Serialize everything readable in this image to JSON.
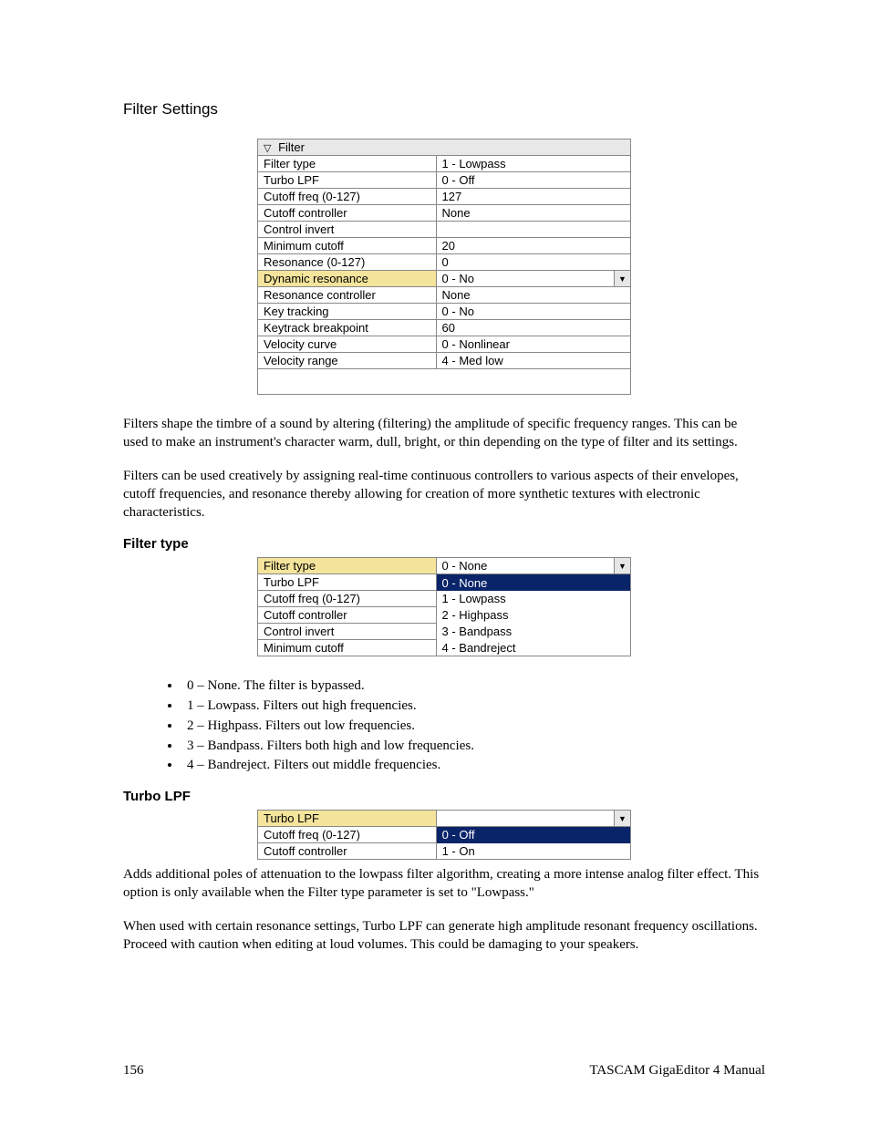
{
  "heading": "Filter Settings",
  "filter_table": {
    "header": "Filter",
    "rows": [
      {
        "label": "Filter type",
        "value": "1 - Lowpass"
      },
      {
        "label": "Turbo LPF",
        "value": "0 - Off"
      },
      {
        "label": "Cutoff freq (0-127)",
        "value": "127"
      },
      {
        "label": "Cutoff controller",
        "value": "None"
      },
      {
        "label": "Control invert",
        "value": ""
      },
      {
        "label": "Minimum cutoff",
        "value": "20"
      },
      {
        "label": "Resonance (0-127)",
        "value": "0"
      },
      {
        "label": "Dynamic resonance",
        "value": "0 - No",
        "selected": true,
        "dropdown": true
      },
      {
        "label": "Resonance controller",
        "value": "None"
      },
      {
        "label": "Key tracking",
        "value": "0 - No"
      },
      {
        "label": "Keytrack breakpoint",
        "value": "60"
      },
      {
        "label": "Velocity curve",
        "value": "0 - Nonlinear"
      },
      {
        "label": "Velocity range",
        "value": "4 - Med low"
      }
    ]
  },
  "para1": "Filters shape the timbre of a sound by altering (filtering) the amplitude of specific frequency ranges.  This can be used to make an instrument's character warm, dull, bright, or thin depending on the type of filter and its settings.",
  "para2": "Filters can be used creatively by assigning real-time continuous controllers to various aspects of their envelopes, cutoff frequencies, and resonance thereby allowing for creation of more synthetic textures with electronic characteristics.",
  "filter_type": {
    "heading": "Filter type",
    "rows": [
      {
        "label": "Filter type",
        "value": "0 - None",
        "selected": true,
        "dropdown": true
      },
      {
        "label": "Turbo LPF",
        "value": "0 - None",
        "opt_selected": true
      },
      {
        "label": "Cutoff freq (0-127)",
        "value": "1 - Lowpass"
      },
      {
        "label": "Cutoff controller",
        "value": "2 - Highpass"
      },
      {
        "label": "Control invert",
        "value": "3 - Bandpass"
      },
      {
        "label": "Minimum cutoff",
        "value": "4 - Bandreject"
      }
    ],
    "bullets": [
      "0 – None.  The filter is bypassed.",
      "1 – Lowpass.  Filters out high frequencies.",
      "2 – Highpass.  Filters out low frequencies.",
      "3 – Bandpass.  Filters both high and low frequencies.",
      "4 – Bandreject.  Filters out middle frequencies."
    ]
  },
  "turbo_lpf": {
    "heading": "Turbo LPF",
    "rows": [
      {
        "label": "Turbo LPF",
        "value": "",
        "selected": true,
        "dropdown": true
      },
      {
        "label": "Cutoff freq (0-127)",
        "value": "0 - Off",
        "opt_selected": true
      },
      {
        "label": "Cutoff controller",
        "value": "1 - On"
      }
    ],
    "para1": "Adds additional poles of attenuation to the lowpass filter algorithm, creating a more intense analog filter effect.  This option is only available when the Filter type parameter is set to \"Lowpass.\"",
    "para2": "When used with certain resonance settings, Turbo LPF can generate high amplitude resonant frequency oscillations.  Proceed with caution when editing at loud volumes.  This could be damaging to your speakers."
  },
  "footer": {
    "page": "156",
    "title": "TASCAM GigaEditor 4 Manual"
  }
}
